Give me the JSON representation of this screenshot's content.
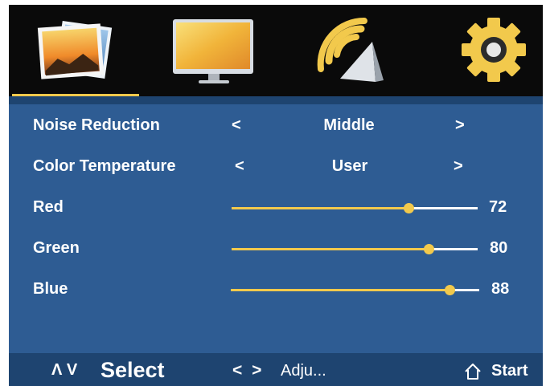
{
  "tabs": [
    {
      "name": "picture",
      "icon": "picture-photos-icon"
    },
    {
      "name": "display",
      "icon": "monitor-icon"
    },
    {
      "name": "audio",
      "icon": "speaker-sound-icon"
    },
    {
      "name": "settings",
      "icon": "gear-icon"
    }
  ],
  "menu": {
    "noise_reduction": {
      "label": "Noise Reduction",
      "value": "Middle",
      "prev": "<",
      "next": ">"
    },
    "color_temperature": {
      "label": "Color Temperature",
      "value": "User",
      "prev": "<",
      "next": ">"
    },
    "red": {
      "label": "Red",
      "value": "72",
      "level": 0.72
    },
    "green": {
      "label": "Green",
      "value": "80",
      "level": 0.8
    },
    "blue": {
      "label": "Blue",
      "value": "88",
      "level": 0.88
    }
  },
  "footer": {
    "nav_arrows": "Λ V",
    "select": "Select",
    "adjust_arrows": "< >",
    "adjust": "Adju...",
    "start": "Start"
  },
  "colors": {
    "accent": "#f2c94c",
    "panel": "#2e5c93",
    "footer": "#1e4470",
    "tabbar": "#0a0a0a"
  }
}
